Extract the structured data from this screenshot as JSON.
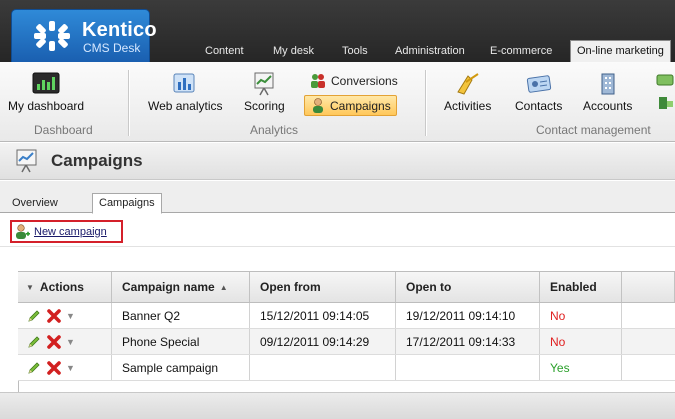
{
  "logo": {
    "title": "Kentico",
    "subtitle": "CMS Desk"
  },
  "top_tabs": [
    {
      "label": "Content"
    },
    {
      "label": "My desk"
    },
    {
      "label": "Tools"
    },
    {
      "label": "Administration"
    },
    {
      "label": "E-commerce"
    },
    {
      "label": "On-line marketing"
    }
  ],
  "ribbon": {
    "dashboard": {
      "label": "My dashboard",
      "group": "Dashboard"
    },
    "analytics": {
      "group": "Analytics",
      "web_analytics": "Web analytics",
      "scoring": "Scoring",
      "conversions": "Conversions",
      "campaigns": "Campaigns"
    },
    "contact_management": {
      "group": "Contact management",
      "activities": "Activities",
      "contacts": "Contacts",
      "accounts": "Accounts"
    }
  },
  "page": {
    "title": "Campaigns"
  },
  "sub_tabs": [
    {
      "label": "Overview"
    },
    {
      "label": "Campaigns"
    }
  ],
  "actions": {
    "new_campaign": "New campaign"
  },
  "grid": {
    "columns": {
      "actions": "Actions",
      "name": "Campaign name",
      "open_from": "Open from",
      "open_to": "Open to",
      "enabled": "Enabled"
    },
    "rows": [
      {
        "name": "Banner Q2",
        "open_from": "15/12/2011 09:14:05",
        "open_to": "19/12/2011 09:14:10",
        "enabled": "No"
      },
      {
        "name": "Phone Special",
        "open_from": "09/12/2011 09:14:29",
        "open_to": "17/12/2011 09:14:33",
        "enabled": "No"
      },
      {
        "name": "Sample campaign",
        "open_from": "",
        "open_to": "",
        "enabled": "Yes"
      }
    ]
  },
  "colors": {
    "header_dark": "#2d2d2d",
    "logo_blue": "#1f6fc4",
    "active_highlight": "#ffc75a",
    "no_red": "#e02020",
    "yes_green": "#2aa02a",
    "callout_red": "#d4202a"
  }
}
